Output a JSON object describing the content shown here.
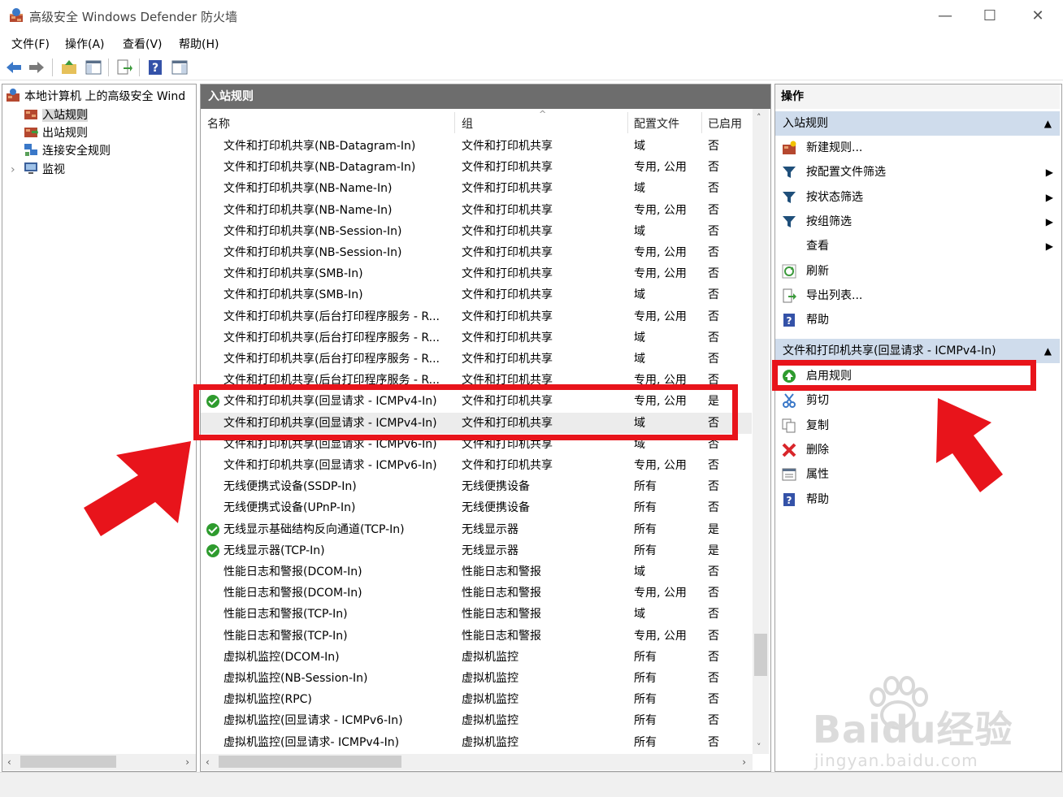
{
  "window": {
    "title": "高级安全 Windows Defender 防火墙",
    "controls": {
      "minimize": "—",
      "maximize": "☐",
      "close": "✕"
    }
  },
  "menu": [
    "文件(F)",
    "操作(A)",
    "查看(V)",
    "帮助(H)"
  ],
  "tree": {
    "root": "本地计算机 上的高级安全 Wind",
    "items": [
      "入站规则",
      "出站规则",
      "连接安全规则",
      "监视"
    ],
    "expander": "›"
  },
  "center": {
    "header": "入站规则",
    "columns": [
      "名称",
      "组",
      "配置文件",
      "已启用"
    ],
    "sort_glyph": "^",
    "rows": [
      {
        "name": "文件和打印机共享(NB-Datagram-In)",
        "group": "文件和打印机共享",
        "profile": "域",
        "enabled": "否",
        "icon": false
      },
      {
        "name": "文件和打印机共享(NB-Datagram-In)",
        "group": "文件和打印机共享",
        "profile": "专用, 公用",
        "enabled": "否",
        "icon": false
      },
      {
        "name": "文件和打印机共享(NB-Name-In)",
        "group": "文件和打印机共享",
        "profile": "域",
        "enabled": "否",
        "icon": false
      },
      {
        "name": "文件和打印机共享(NB-Name-In)",
        "group": "文件和打印机共享",
        "profile": "专用, 公用",
        "enabled": "否",
        "icon": false
      },
      {
        "name": "文件和打印机共享(NB-Session-In)",
        "group": "文件和打印机共享",
        "profile": "域",
        "enabled": "否",
        "icon": false
      },
      {
        "name": "文件和打印机共享(NB-Session-In)",
        "group": "文件和打印机共享",
        "profile": "专用, 公用",
        "enabled": "否",
        "icon": false
      },
      {
        "name": "文件和打印机共享(SMB-In)",
        "group": "文件和打印机共享",
        "profile": "专用, 公用",
        "enabled": "否",
        "icon": false
      },
      {
        "name": "文件和打印机共享(SMB-In)",
        "group": "文件和打印机共享",
        "profile": "域",
        "enabled": "否",
        "icon": false
      },
      {
        "name": "文件和打印机共享(后台打印程序服务 - R...",
        "group": "文件和打印机共享",
        "profile": "专用, 公用",
        "enabled": "否",
        "icon": false
      },
      {
        "name": "文件和打印机共享(后台打印程序服务 - R...",
        "group": "文件和打印机共享",
        "profile": "域",
        "enabled": "否",
        "icon": false
      },
      {
        "name": "文件和打印机共享(后台打印程序服务 - R...",
        "group": "文件和打印机共享",
        "profile": "域",
        "enabled": "否",
        "icon": false
      },
      {
        "name": "文件和打印机共享(后台打印程序服务 - R...",
        "group": "文件和打印机共享",
        "profile": "专用, 公用",
        "enabled": "否",
        "icon": false
      },
      {
        "name": "文件和打印机共享(回显请求 - ICMPv4-In)",
        "group": "文件和打印机共享",
        "profile": "专用, 公用",
        "enabled": "是",
        "icon": true
      },
      {
        "name": "文件和打印机共享(回显请求 - ICMPv4-In)",
        "group": "文件和打印机共享",
        "profile": "域",
        "enabled": "否",
        "icon": false
      },
      {
        "name": "文件和打印机共享(回显请求 - ICMPv6-In)",
        "group": "文件和打印机共享",
        "profile": "域",
        "enabled": "否",
        "icon": false
      },
      {
        "name": "文件和打印机共享(回显请求 - ICMPv6-In)",
        "group": "文件和打印机共享",
        "profile": "专用, 公用",
        "enabled": "否",
        "icon": false
      },
      {
        "name": "无线便携式设备(SSDP-In)",
        "group": "无线便携设备",
        "profile": "所有",
        "enabled": "否",
        "icon": false
      },
      {
        "name": "无线便携式设备(UPnP-In)",
        "group": "无线便携设备",
        "profile": "所有",
        "enabled": "否",
        "icon": false
      },
      {
        "name": "无线显示基础结构反向通道(TCP-In)",
        "group": "无线显示器",
        "profile": "所有",
        "enabled": "是",
        "icon": true
      },
      {
        "name": "无线显示器(TCP-In)",
        "group": "无线显示器",
        "profile": "所有",
        "enabled": "是",
        "icon": true
      },
      {
        "name": "性能日志和警报(DCOM-In)",
        "group": "性能日志和警报",
        "profile": "域",
        "enabled": "否",
        "icon": false
      },
      {
        "name": "性能日志和警报(DCOM-In)",
        "group": "性能日志和警报",
        "profile": "专用, 公用",
        "enabled": "否",
        "icon": false
      },
      {
        "name": "性能日志和警报(TCP-In)",
        "group": "性能日志和警报",
        "profile": "域",
        "enabled": "否",
        "icon": false
      },
      {
        "name": "性能日志和警报(TCP-In)",
        "group": "性能日志和警报",
        "profile": "专用, 公用",
        "enabled": "否",
        "icon": false
      },
      {
        "name": "虚拟机监控(DCOM-In)",
        "group": "虚拟机监控",
        "profile": "所有",
        "enabled": "否",
        "icon": false
      },
      {
        "name": "虚拟机监控(NB-Session-In)",
        "group": "虚拟机监控",
        "profile": "所有",
        "enabled": "否",
        "icon": false
      },
      {
        "name": "虚拟机监控(RPC)",
        "group": "虚拟机监控",
        "profile": "所有",
        "enabled": "否",
        "icon": false
      },
      {
        "name": "虚拟机监控(回显请求 - ICMPv6-In)",
        "group": "虚拟机监控",
        "profile": "所有",
        "enabled": "否",
        "icon": false
      },
      {
        "name": "虚拟机监控(回显请求- ICMPv4-In)",
        "group": "虚拟机监控",
        "profile": "所有",
        "enabled": "否",
        "icon": false
      }
    ]
  },
  "actions": {
    "header": "操作",
    "section1": "入站规则",
    "section1_items": [
      {
        "label": "新建规则...",
        "icon": "new-rule-icon",
        "submenu": false
      },
      {
        "label": "按配置文件筛选",
        "icon": "filter-icon",
        "submenu": true
      },
      {
        "label": "按状态筛选",
        "icon": "filter-icon",
        "submenu": true
      },
      {
        "label": "按组筛选",
        "icon": "filter-icon",
        "submenu": true
      },
      {
        "label": "查看",
        "icon": "",
        "submenu": true
      },
      {
        "label": "刷新",
        "icon": "refresh-icon",
        "submenu": false
      },
      {
        "label": "导出列表...",
        "icon": "export-icon",
        "submenu": false
      },
      {
        "label": "帮助",
        "icon": "help-icon",
        "submenu": false
      }
    ],
    "section2": "文件和打印机共享(回显请求 - ICMPv4-In)",
    "section2_items": [
      {
        "label": "启用规则",
        "icon": "enable-rule-icon"
      },
      {
        "label": "剪切",
        "icon": "cut-icon"
      },
      {
        "label": "复制",
        "icon": "copy-icon"
      },
      {
        "label": "删除",
        "icon": "delete-icon"
      },
      {
        "label": "属性",
        "icon": "properties-icon"
      },
      {
        "label": "帮助",
        "icon": "help-icon"
      }
    ],
    "collapse_glyph": "▲",
    "submenu_glyph": "▶"
  },
  "watermark": {
    "brand": "Baidu经验",
    "url": "jingyan.baidu.com"
  },
  "colors": {
    "annotation_red": "#e8141b",
    "section_blue": "#cfdcec",
    "header_gray": "#6d6d6d",
    "check_green": "#2e9b2e"
  }
}
